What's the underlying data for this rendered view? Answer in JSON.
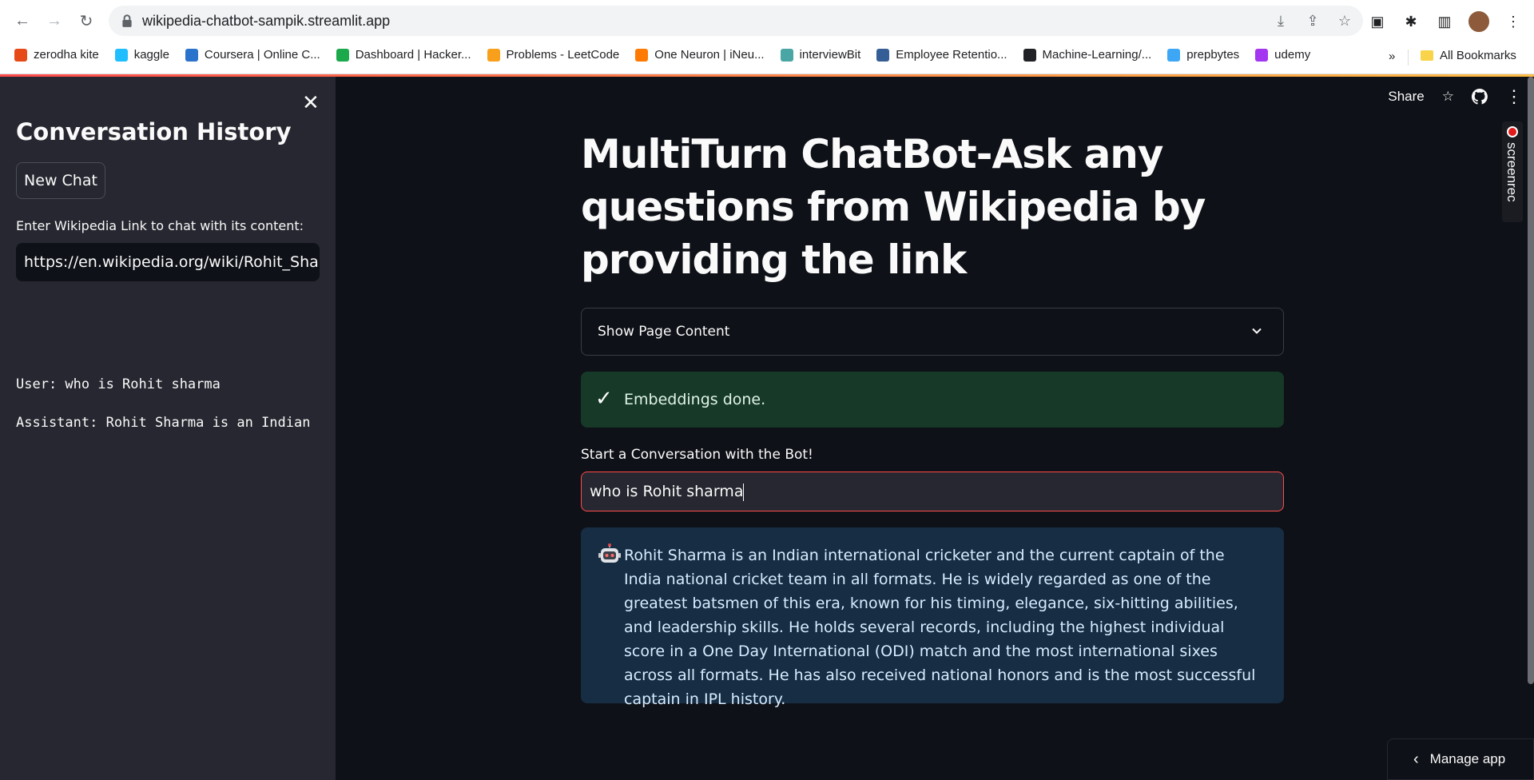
{
  "browser": {
    "url": "wikipedia-chatbot-sampik.streamlit.app",
    "bookmarks": [
      {
        "label": "zerodha kite",
        "icon": "zerodha-icon",
        "color": "#e64a19"
      },
      {
        "label": "kaggle",
        "icon": "kaggle-icon",
        "color": "#20beff"
      },
      {
        "label": "Coursera | Online C...",
        "icon": "coursera-icon",
        "color": "#2a73cc"
      },
      {
        "label": "Dashboard | Hacker...",
        "icon": "hackerrank-icon",
        "color": "#1ba94c"
      },
      {
        "label": "Problems - LeetCode",
        "icon": "leetcode-icon",
        "color": "#f89f1b"
      },
      {
        "label": "One Neuron | iNeu...",
        "icon": "ineuron-icon",
        "color": "#ff7a00"
      },
      {
        "label": "interviewBit",
        "icon": "interviewbit-icon",
        "color": "#4aa5a5"
      },
      {
        "label": "Employee Retentio...",
        "icon": "tds-icon",
        "color": "#355e96"
      },
      {
        "label": "Machine-Learning/...",
        "icon": "github-icon",
        "color": "#202124"
      },
      {
        "label": "prepbytes",
        "icon": "prepbytes-icon",
        "color": "#3ea7f5"
      },
      {
        "label": "udemy",
        "icon": "udemy-icon",
        "color": "#a435f0"
      }
    ],
    "more": "»",
    "all_bookmarks": "All Bookmarks"
  },
  "sidebar": {
    "title": "Conversation History",
    "new_chat": "New Chat",
    "link_label": "Enter Wikipedia Link to chat with its content:",
    "link_value": "https://en.wikipedia.org/wiki/Rohit_Sharma",
    "history": [
      "User: who is Rohit sharma",
      "Assistant: Rohit Sharma is an Indian"
    ]
  },
  "toolbar": {
    "share": "Share"
  },
  "screenrec": "screenrec",
  "main": {
    "title": "MultiTurn ChatBot-Ask any questions from Wikipedia by providing the link",
    "expander_label": "Show Page Content",
    "success": "Embeddings done.",
    "conversation_label": "Start a Conversation with the Bot!",
    "conversation_value": "who is Rohit sharma",
    "answer": "Rohit Sharma is an Indian international cricketer and the current captain of the India national cricket team in all formats. He is widely regarded as one of the greatest batsmen of this era, known for his timing, elegance, six-hitting abilities, and leadership skills. He holds several records, including the highest individual score in a One Day International (ODI) match and the most international sixes across all formats. He has also received national honors and is the most successful captain in IPL history."
  },
  "manage_app": "Manage app",
  "colors": {
    "accent": "#ff4b4b",
    "success_bg": "#173928",
    "info_bg": "#172d43",
    "sidebar_bg": "#262730",
    "main_bg": "#0e1117"
  }
}
